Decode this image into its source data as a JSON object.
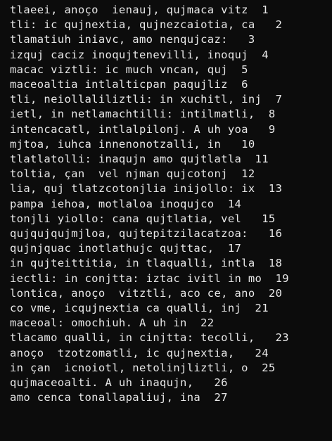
{
  "terminal": {
    "lines": [
      "tlaeei, anoço  ienauj, qujmaca vitz  1",
      "tli: ic qujnextia, qujnezcaiotia, ca   2",
      "tlamatiuh iniavc, amo nenqujcaz:   3",
      "izquj caciz inoqujtenevilli, inoquj  4",
      "macac viztli: ic much vncan, quj  5",
      "maceoaltia intlalticpan paqujliz  6",
      "tli, neiollaliliztli: in xuchitl, inj  7",
      "ietl, in netlamachtilli: intilmatli,  8",
      "intencacatl, intlalpilonj. A uh yoa   9",
      "mjtoa, iuhca innenonotzalli, in   10",
      "tlatlatolli: inaqujn amo qujtlatla  11",
      "toltia, çan  vel njman qujcotonj  12",
      "lia, quj tlatzcotonjlia inijollo: ix  13",
      "pampa iehoa, motlaloa inoqujco  14",
      "tonjli yiollo: cana qujtlatia, vel   15",
      "qujqujqujmjloa, qujtepitzilacatzoa:   16",
      "qujnjquac inotlathujc qujttac,  17",
      "in qujteittitia, in tlaqualli, intla  18",
      "iectli: in conjtta: iztac ivitl in mo  19",
      "lontica, anoço  vitztli, aco ce, ano  20",
      "co vme, icqujnextia ca qualli, inj  21",
      "maceoal: omochiuh. A uh in  22",
      "tlacamo qualli, in cinjtta: tecolli,   23",
      "anoço  tzotzomatli, ic qujnextia,   24",
      "in çan  icnoiotl, netolinjliztli, o  25",
      "qujmaceoalti. A uh inaqujn,   26",
      "amo cenca tonallapaliuj, ina  27"
    ]
  }
}
